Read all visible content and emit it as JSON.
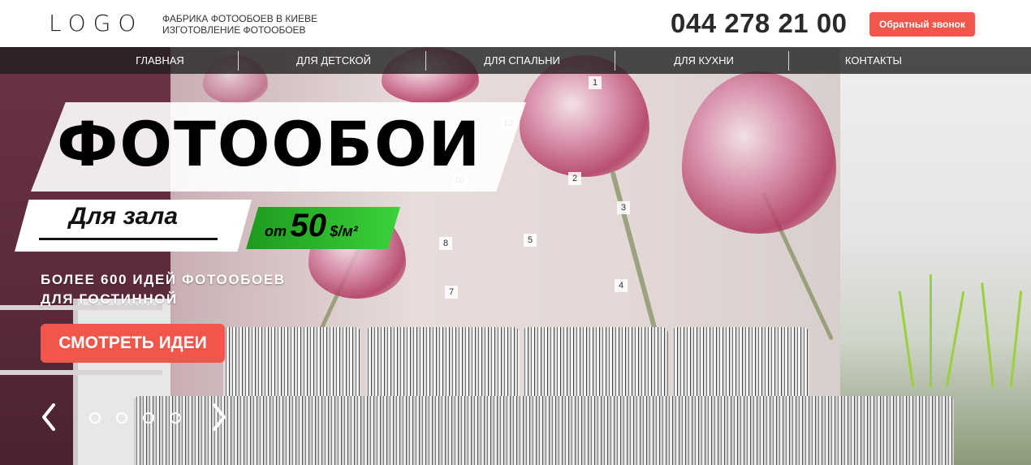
{
  "header": {
    "logo": "LOGO",
    "tagline_line1": "ФАБРИКА ФОТООБОЕВ В КИЕВЕ",
    "tagline_line2": "ИЗГОТОВЛЕНИЕ ФОТООБОЕВ",
    "phone": "044 278 21 00",
    "callback_label": "Обратный звонок"
  },
  "nav": {
    "items": [
      {
        "label": "ГЛАВНАЯ"
      },
      {
        "label": "ДЛЯ ДЕТСКОЙ"
      },
      {
        "label": "ДЛЯ СПАЛЬНИ"
      },
      {
        "label": "ДЛЯ КУХНИ"
      },
      {
        "label": "КОНТАКТЫ"
      }
    ]
  },
  "hero": {
    "title": "ФОТООБОИ",
    "subtitle": "Для зала",
    "price_from": "от",
    "price_value": "50",
    "price_unit": "$/м²",
    "desc_line1": "БОЛЕЕ 600 ИДЕЙ ФОТООБОЕВ",
    "desc_line2": "ДЛЯ ГОСТИННОЙ",
    "cta_label": "СМОТРЕТЬ ИДЕИ",
    "slides_count": 4,
    "clock_numbers": [
      "1",
      "12",
      "2",
      "10",
      "3",
      "8",
      "5",
      "7",
      "4"
    ]
  },
  "colors": {
    "accent": "#f0564a",
    "price_green": "#2fbf2f",
    "nav_bg": "#1e1e1e",
    "text_dark": "#2a2a2a"
  },
  "icons": {
    "prev": "chevron-left-icon",
    "next": "chevron-right-icon"
  }
}
